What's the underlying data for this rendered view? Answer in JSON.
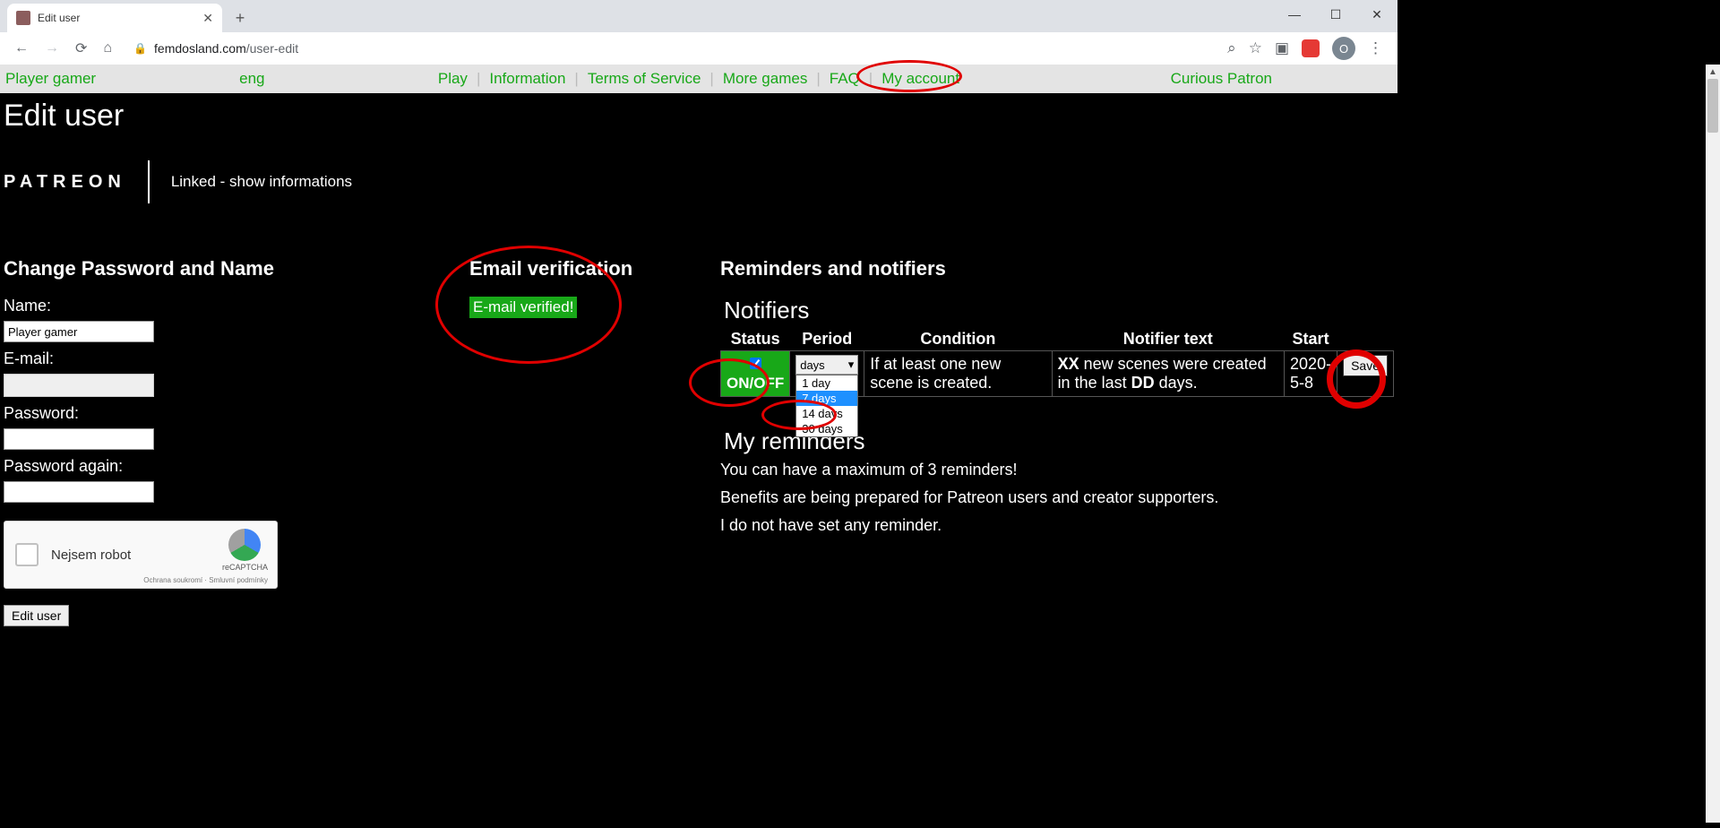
{
  "browser": {
    "tab_title": "Edit user",
    "url_host": "femdosland.com",
    "url_path": "/user-edit",
    "avatar_letter": "O"
  },
  "nav": {
    "player_label": "Player gamer",
    "lang": "eng",
    "items": [
      "Play",
      "Information",
      "Terms of Service",
      "More games",
      "FAQ",
      "My account"
    ],
    "right_label": "Curious Patron"
  },
  "page": {
    "title": "Edit user",
    "patreon_logo": "PATREON",
    "patreon_linked": "Linked - show informations"
  },
  "col1": {
    "heading": "Change Password and Name",
    "name_label": "Name:",
    "name_value": "Player gamer",
    "email_label": "E-mail:",
    "password_label": "Password:",
    "password_again_label": "Password again:",
    "recaptcha_label": "Nejsem robot",
    "recaptcha_brand": "reCAPTCHA",
    "recaptcha_foot": "Ochrana soukromí · Smluvní podmínky",
    "edit_button": "Edit user"
  },
  "col2": {
    "heading": "Email verification",
    "verified": "E-mail verified!"
  },
  "col3": {
    "heading": "Reminders and notifiers",
    "notifiers_heading": "Notifiers",
    "headers": [
      "Status",
      "Period",
      "Condition",
      "Notifier text",
      "Start"
    ],
    "row": {
      "onoff": "ON/OFF",
      "checked": true,
      "period_selected": "7 days",
      "period_display": "days",
      "period_options": [
        "1 day",
        "7 days",
        "14 days",
        "30 days"
      ],
      "condition": "If at least one new scene is created.",
      "notifier_prefix": "XX",
      "notifier_mid": " new scenes were created in the last ",
      "notifier_bold": "DD",
      "notifier_suffix": " days.",
      "start": "2020-5-8",
      "save": "Save"
    },
    "myreminders_heading": "My reminders",
    "line1": "You can have a maximum of 3 reminders!",
    "line2": "Benefits are being prepared for Patreon users and creator supporters.",
    "line3": "I do not have set any reminder."
  }
}
